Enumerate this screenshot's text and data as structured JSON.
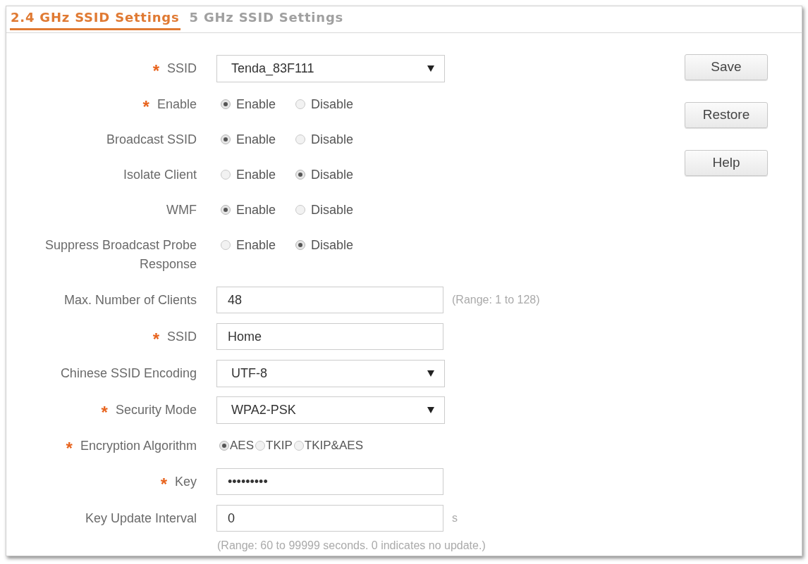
{
  "tabs": [
    {
      "label": "2.4 GHz SSID Settings",
      "selected": true
    },
    {
      "label": "5 GHz SSID Settings",
      "selected": false
    }
  ],
  "fields": [
    {
      "kind": "select",
      "label": "SSID",
      "marker": "*",
      "value": "Tenda_83F111"
    },
    {
      "kind": "radio",
      "label": "Enable",
      "marker": "*",
      "options": [
        {
          "label": "Enable",
          "selected": true
        },
        {
          "label": "Disable",
          "selected": false
        }
      ]
    },
    {
      "kind": "radio",
      "label": "Broadcast SSID",
      "options": [
        {
          "label": "Enable",
          "selected": true
        },
        {
          "label": "Disable",
          "selected": false
        }
      ]
    },
    {
      "kind": "radio",
      "label": "Isolate Client",
      "options": [
        {
          "label": "Enable",
          "selected": false
        },
        {
          "label": "Disable",
          "selected": true
        }
      ]
    },
    {
      "kind": "radio",
      "label": "WMF",
      "options": [
        {
          "label": "Enable",
          "selected": true
        },
        {
          "label": "Disable",
          "selected": false
        }
      ]
    },
    {
      "kind": "radio",
      "label": "Suppress Broadcast Probe Response",
      "options": [
        {
          "label": "Enable",
          "selected": false
        },
        {
          "label": "Disable",
          "selected": true
        }
      ]
    },
    {
      "kind": "input",
      "label": "Max. Number of Clients",
      "value": "48",
      "hint": "(Range: 1 to 128)"
    },
    {
      "kind": "input",
      "label": "SSID",
      "marker": "*",
      "value": "Home"
    },
    {
      "kind": "select",
      "label": "Chinese SSID Encoding",
      "value": "UTF-8"
    },
    {
      "kind": "select",
      "label": "Security Mode",
      "marker": "*",
      "value": "WPA2-PSK"
    },
    {
      "kind": "radio_inline",
      "label": "Encryption Algorithm",
      "marker": "*",
      "options": [
        {
          "label": "AES",
          "selected": true
        },
        {
          "label": "TKIP",
          "selected": false
        },
        {
          "label": "TKIP&AES",
          "selected": false
        }
      ]
    },
    {
      "kind": "input",
      "label": "Key",
      "marker": "*",
      "value": "•••••••••"
    },
    {
      "kind": "input",
      "label": "Key Update Interval",
      "value": "0",
      "hint": "s",
      "note": "(Range: 60 to 99999 seconds. 0 indicates no update.)"
    }
  ],
  "buttons": [
    "Save",
    "Restore",
    "Help"
  ]
}
